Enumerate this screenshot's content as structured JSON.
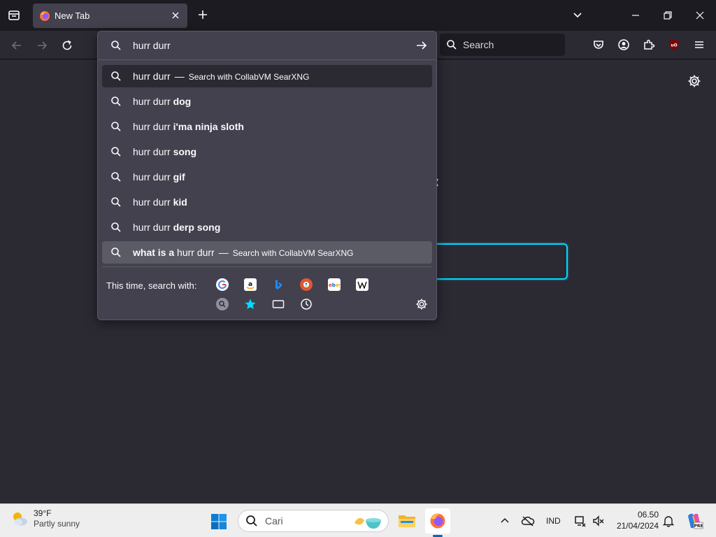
{
  "tab": {
    "title": "New Tab"
  },
  "navbar": {
    "search_placeholder": "Search"
  },
  "urlbar": {
    "value": "hurr durr",
    "results": [
      {
        "prefix": "",
        "query": "hurr durr",
        "suffix": "",
        "action": "Search with CollabVM SearXNG"
      },
      {
        "prefix": "",
        "query": "hurr durr",
        "suffix": "dog",
        "action": ""
      },
      {
        "prefix": "",
        "query": "hurr durr",
        "suffix": "i'ma ninja sloth",
        "action": ""
      },
      {
        "prefix": "",
        "query": "hurr durr",
        "suffix": "song",
        "action": ""
      },
      {
        "prefix": "",
        "query": "hurr durr",
        "suffix": "gif",
        "action": ""
      },
      {
        "prefix": "",
        "query": "hurr durr",
        "suffix": "kid",
        "action": ""
      },
      {
        "prefix": "",
        "query": "hurr durr",
        "suffix": "derp song",
        "action": ""
      },
      {
        "prefix": "what is a",
        "query": "hurr durr",
        "suffix": "",
        "action": "Search with CollabVM SearXNG"
      }
    ],
    "separator": "—",
    "oneoff_label": "This time, search with:",
    "engines": [
      "google-icon",
      "amazon-icon",
      "bing-icon",
      "duckduckgo-icon",
      "ebay-icon",
      "wikipedia-icon",
      "searxng-icon",
      "bookmarks-icon",
      "tabs-icon",
      "history-icon"
    ]
  },
  "taskbar": {
    "weather_temp": "39°F",
    "weather_cond": "Partly sunny",
    "search_placeholder": "Cari",
    "lang": "IND",
    "time": "06.50",
    "date": "21/04/2024"
  },
  "colors": {
    "accent": "#00ddff",
    "popup_bg": "#42414d",
    "toolbar_bg": "#2b2a33",
    "tabstrip_bg": "#1c1b22",
    "ublock": "#800000"
  }
}
